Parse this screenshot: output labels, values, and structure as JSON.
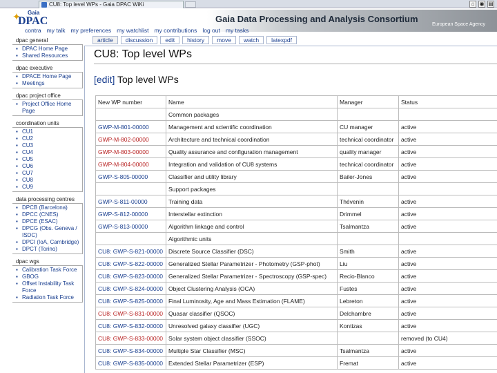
{
  "browser": {
    "tab_title": "CU8: Top level WPs - Gaia DPAC WiKi"
  },
  "site": {
    "logo_small": "Gaia",
    "logo_main": "DPAC",
    "title": "Gaia Data Processing and Analysis Consortium",
    "esa": "European Space Agency"
  },
  "user_links": [
    "contra",
    "my talk",
    "my preferences",
    "my watchlist",
    "my contributions",
    "log out",
    "my tasks"
  ],
  "page_tabs": [
    "article",
    "discussion",
    "edit",
    "history",
    "move",
    "watch",
    "latexpdf"
  ],
  "sidebar": {
    "sections": [
      {
        "heading": "dpac general",
        "items": [
          "DPAC Home Page",
          "Shared Resources"
        ]
      },
      {
        "heading": "dpac executive",
        "items": [
          "DPACE Home Page",
          "Meetings"
        ]
      },
      {
        "heading": "dpac project office",
        "items": [
          "Project Office Home Page"
        ]
      },
      {
        "heading": "coordination units",
        "items": [
          "CU1",
          "CU2",
          "CU3",
          "CU4",
          "CU5",
          "CU6",
          "CU7",
          "CU8",
          "CU9"
        ]
      },
      {
        "heading": "data processing centres",
        "items": [
          "DPCB (Barcelona)",
          "DPCC (CNES)",
          "DPCE (ESAC)",
          "DPCG (Obs. Geneva / ISDC)",
          "DPCI (IoA, Cambridge)",
          "DPCT (Torino)"
        ]
      },
      {
        "heading": "dpac wgs",
        "items": [
          "Calibration Task Force",
          "GBOG",
          "Offset Instability Task Force",
          "Radiation Task Force"
        ]
      }
    ]
  },
  "page": {
    "title": "CU8: Top level WPs",
    "edit_label": "[edit]",
    "heading": "Top level WPs"
  },
  "table": {
    "headers": [
      "New WP number",
      "Name",
      "Manager",
      "Status"
    ],
    "rows": [
      {
        "section": true,
        "number": "",
        "name": "Common packages",
        "manager": "",
        "status": ""
      },
      {
        "number": "GWP-M-801-00000",
        "color": "blue",
        "name": "Management and scientific coordination",
        "manager": "CU manager",
        "status": "active"
      },
      {
        "number": "GWP-M-802-00000",
        "color": "red",
        "name": "Architecture and technical coordination",
        "manager": "technical coordinator",
        "status": "active"
      },
      {
        "number": "GWP-M-803-00000",
        "color": "red",
        "name": "Quality assurance and configuration management",
        "manager": "quality manager",
        "status": "active"
      },
      {
        "number": "GWP-M-804-00000",
        "color": "red",
        "name": "Integration and validation of CU8 systems",
        "manager": "technical coordinator",
        "status": "active"
      },
      {
        "number": "GWP-S-805-00000",
        "color": "blue",
        "name": "Classifier and utility library",
        "manager": "Bailer-Jones",
        "status": "active"
      },
      {
        "section": true,
        "number": "",
        "name": "Support packages",
        "manager": "",
        "status": ""
      },
      {
        "number": "GWP-S-811-00000",
        "color": "blue",
        "name": "Training data",
        "manager": "Thévenin",
        "status": "active"
      },
      {
        "number": "GWP-S-812-00000",
        "color": "blue",
        "name": "Interstellar extinction",
        "manager": "Drimmel",
        "status": "active"
      },
      {
        "number": "GWP-S-813-00000",
        "color": "blue",
        "name": "Algorithm linkage and control",
        "manager": "Tsalmantza",
        "status": "active"
      },
      {
        "section": true,
        "number": "",
        "name": "Algorithmic units",
        "manager": "",
        "status": ""
      },
      {
        "number": "CU8: GWP-S-821-00000",
        "color": "blue",
        "name": "Discrete Source Classifier (DSC)",
        "manager": "Smith",
        "status": "active"
      },
      {
        "number": "CU8: GWP-S-822-00000",
        "color": "blue",
        "name": "Generalized Stellar Parametrizer - Photometry (GSP-phot)",
        "manager": "Liu",
        "status": "active"
      },
      {
        "number": "CU8: GWP-S-823-00000",
        "color": "blue",
        "name": "Generalized Stellar Parametrizer - Spectroscopy (GSP-spec)",
        "manager": "Recio-Blanco",
        "status": "active"
      },
      {
        "number": "CU8: GWP-S-824-00000",
        "color": "blue",
        "name": "Object Clustering Analysis (OCA)",
        "manager": "Fustes",
        "status": "active"
      },
      {
        "number": "CU8: GWP-S-825-00000",
        "color": "blue",
        "name": "Final Luminosity, Age and Mass Estimation (FLAME)",
        "manager": "Lebreton",
        "status": "active"
      },
      {
        "number": "CU8: GWP-S-831-00000",
        "color": "red",
        "name": "Quasar classifier (QSOC)",
        "manager": "Delchambre",
        "status": "active"
      },
      {
        "number": "CU8: GWP-S-832-00000",
        "color": "blue",
        "name": "Unresolved galaxy classifier (UGC)",
        "manager": "Kontizas",
        "status": "active"
      },
      {
        "number": "CU8: GWP-S-833-00000",
        "color": "red",
        "name": "Solar system object classifier (SSOC)",
        "manager": "",
        "status": "removed (to CU4)"
      },
      {
        "number": "CU8: GWP-S-834-00000",
        "color": "blue",
        "name": "Multiple Star Classifier (MSC)",
        "manager": "Tsalmantza",
        "status": "active"
      },
      {
        "number": "CU8: GWP-S-835-00000",
        "color": "blue",
        "name": "Extended Stellar Parametrizer (ESP)",
        "manager": "Fremat",
        "status": "active"
      }
    ]
  }
}
